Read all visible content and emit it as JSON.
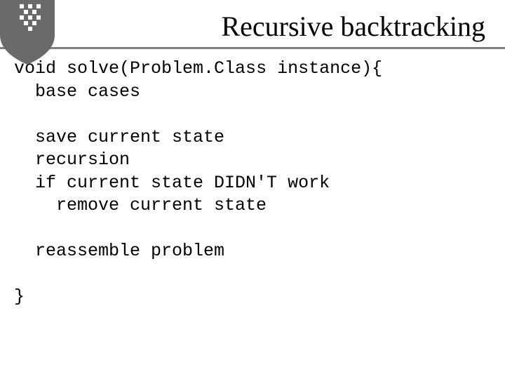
{
  "title": "Recursive backtracking",
  "code": {
    "l1a": "void ",
    "l1b": "solve",
    "l1c": "(Problem.Class instance){",
    "l2": "  base cases",
    "l3": "",
    "l4": "  save current state",
    "l5": "  recursion",
    "l6": "  if current state DIDN'T work",
    "l7": "    remove current state",
    "l8": "",
    "l9": "  reassemble problem",
    "l10": "",
    "l11": "}"
  }
}
